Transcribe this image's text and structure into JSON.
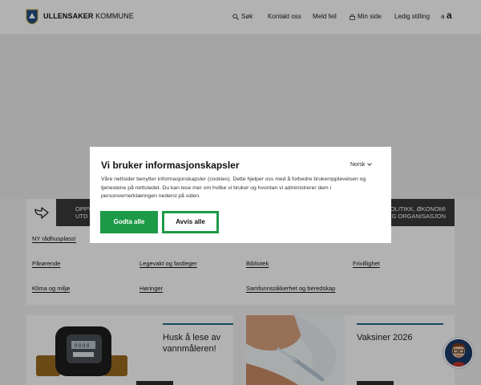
{
  "header": {
    "brand_bold": "ULLENSAKER",
    "brand_rest": " KOMMUNE",
    "nav": {
      "search": "Søk",
      "contact": "Kontakt oss",
      "report": "Meld feil",
      "mypage": "Min side",
      "jobs": "Ledig stilling"
    },
    "font_small": "a",
    "font_large": "a"
  },
  "strip": {
    "left_line1": "OPPV",
    "left_line2": "UTD",
    "right_line1": "OLITIKK, ØKONOMI",
    "right_line2": "G ORGANISASJON"
  },
  "links": [
    "NY rådhusplass!",
    "Pårørende",
    "Legevakt og fastleger",
    "Bibliotek",
    "Frivillighet",
    "Klima og miljø",
    "Høringer",
    "Samfunnssikkerhet og beredskap"
  ],
  "cards": [
    {
      "title": "Husk å lese av vannmåleren!"
    },
    {
      "title": "Vaksiner 2026"
    }
  ],
  "cookie": {
    "title": "Vi bruker informasjonskapsler",
    "text": "Våre nettsider benytter informasjonskapsler (cookies). Dette hjelper oss med å forbedre brukeropplevelsen og tjenestene på nettstedet. Du kan lese mer om hvilke vi bruker og hvordan vi administrerer dem i personvernerklæringen nederst på siden.",
    "language": "Norsk",
    "accept": "Godta alle",
    "reject": "Avvis alle"
  },
  "colors": {
    "accent_green": "#1d9a48",
    "strip_dark": "#3a3a3a",
    "card_rule": "#1f6b8c"
  }
}
